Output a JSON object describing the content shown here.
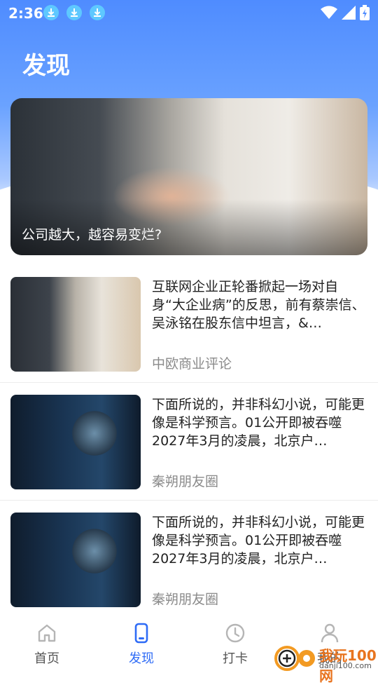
{
  "status_bar": {
    "time": "2:36"
  },
  "header": {
    "title": "发现"
  },
  "banner": {
    "caption": "公司越大，越容易变烂?"
  },
  "articles": [
    {
      "text": "互联网企业正轮番掀起一场对自身“大企业病”的反思，前有蔡崇信、吴泳铭在股东信中坦言，&…",
      "source": "中欧商业评论"
    },
    {
      "text": "下面所说的，并非科幻小说，可能更像是科学预言。01公开即被吞噬2027年3月的凌晨，北京户…",
      "source": "秦朔朋友圈"
    },
    {
      "text": "下面所说的，并非科幻小说，可能更像是科学预言。01公开即被吞噬2027年3月的凌晨，北京户…",
      "source": "秦朔朋友圈"
    }
  ],
  "tabs": [
    {
      "label": "首页",
      "icon": "home-icon"
    },
    {
      "label": "发现",
      "icon": "phone-icon"
    },
    {
      "label": "打卡",
      "icon": "clock-icon"
    },
    {
      "label": "我的",
      "icon": "user-icon"
    }
  ],
  "watermark": {
    "text": "我玩100网",
    "url": "danji100.com"
  },
  "colors": {
    "accent": "#2f6cf6",
    "header": "#4f8cff"
  }
}
